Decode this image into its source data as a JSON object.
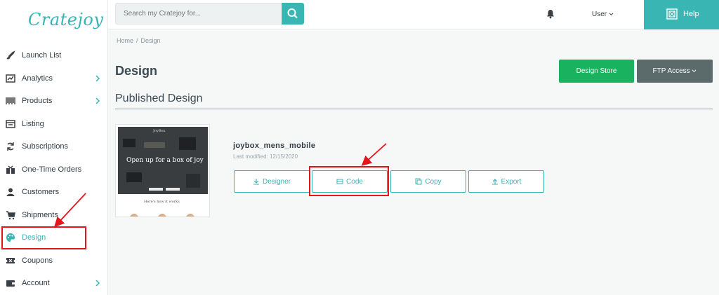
{
  "app": {
    "logo_text": "Cratejoy"
  },
  "sidebar": {
    "items": [
      {
        "label": "Launch List",
        "icon": "rocket-icon",
        "has_chevron": false
      },
      {
        "label": "Analytics",
        "icon": "chart-icon",
        "has_chevron": true
      },
      {
        "label": "Products",
        "icon": "barcode-icon",
        "has_chevron": true
      },
      {
        "label": "Listing",
        "icon": "listing-icon",
        "has_chevron": false
      },
      {
        "label": "Subscriptions",
        "icon": "refresh-icon",
        "has_chevron": false
      },
      {
        "label": "One-Time Orders",
        "icon": "gift-icon",
        "has_chevron": false
      },
      {
        "label": "Customers",
        "icon": "user-icon",
        "has_chevron": false
      },
      {
        "label": "Shipments",
        "icon": "cart-icon",
        "has_chevron": false
      },
      {
        "label": "Design",
        "icon": "palette-icon",
        "has_chevron": false,
        "active": true
      },
      {
        "label": "Coupons",
        "icon": "ticket-icon",
        "has_chevron": false
      },
      {
        "label": "Account",
        "icon": "wallet-icon",
        "has_chevron": true
      }
    ]
  },
  "topbar": {
    "search_placeholder": "Search my Cratejoy for...",
    "user_label": "User",
    "help_label": "Help"
  },
  "breadcrumb": {
    "home": "Home",
    "sep": "/",
    "current": "Design"
  },
  "page": {
    "title": "Design",
    "design_store_label": "Design Store",
    "ftp_access_label": "FTP Access"
  },
  "published": {
    "section_title": "Published Design",
    "thumbnail": {
      "brand": "JoyBox",
      "headline": "Open up for a box of joy",
      "subheading": "Here's how it works"
    },
    "theme_name": "joybox_mens_mobile",
    "last_modified": "Last modified: 12/15/2020",
    "actions": {
      "designer": "Designer",
      "code": "Code",
      "copy": "Copy",
      "export": "Export"
    }
  },
  "colors": {
    "accent": "#39b5b3",
    "store_button": "#19b35f",
    "ftp_button": "#5b6b6b",
    "highlight": "#e4151b"
  }
}
